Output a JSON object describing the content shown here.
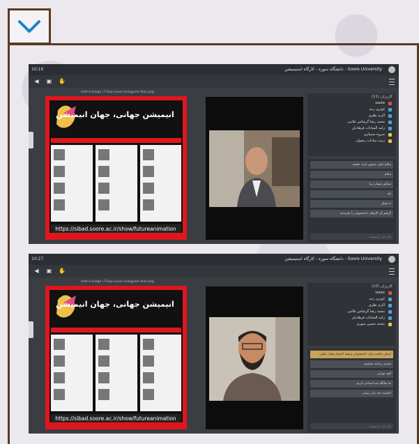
{
  "toggle": {
    "icon": "chevron-down-icon"
  },
  "screens": [
    {
      "time": "10:16",
      "title": "دانشگاه سوره - کارگاه اسنیمیشن - Soore University",
      "presentation": "Haft-e-Eshgh (7-Day-Love) Instagram Post.png",
      "participants_title": "کاربران (11)",
      "participants": [
        "soore",
        "کوثری رتبه",
        "اکرم نظری",
        "محمد رضا گرشاس غلامی",
        "زکیه السادات فرهادیان",
        "سروه سمیاری",
        "زینب سادات رضوان"
      ],
      "chat_messages": [
        "سلام خیلی ممنون بابت جلسه",
        "سلام",
        "سپاس بسیار زیبا",
        "بله",
        "با تشکر",
        "گرفتم آن کارهای دانشجویان را بفرستید"
      ],
      "chat_placeholder": "پیام خود را بنویسید"
    },
    {
      "time": "10:27",
      "title": "دانشگاه سوره - کارگاه اسنیمیشن - Soore University",
      "presentation": "Haft-e-Eshgh (7-Day-Love) Instagram Post.png",
      "participants_title": "کاربران (10)",
      "participants": [
        "soore",
        "کوثری رتبه",
        "اکرم نظری",
        "محمد رضا گرشاس غلامی",
        "زکیه السادات فرهادیان",
        "محمد حسین سوری"
      ],
      "chat_messages": [
        "اسکن جلسه برای دانشجویان و همه اعضای هیات علمی",
        "مجری برنامه شیلیمو",
        "الهه نورانی",
        "ما شاالله چه استادی داریم",
        "احسنت چه بیان زیبایی"
      ],
      "chat_placeholder": "پیام خود را بنویسید"
    }
  ],
  "poster": {
    "heading": "انیمیشن جهانی، جهان انیمیشن",
    "url": "https://sibad.soore.ac.ir/show/futureanimation"
  },
  "colors": {
    "frame": "#5a3a20",
    "poster": "#e0161e",
    "chevron": "#1a84c9",
    "dark_bg": "#3a3d42"
  }
}
